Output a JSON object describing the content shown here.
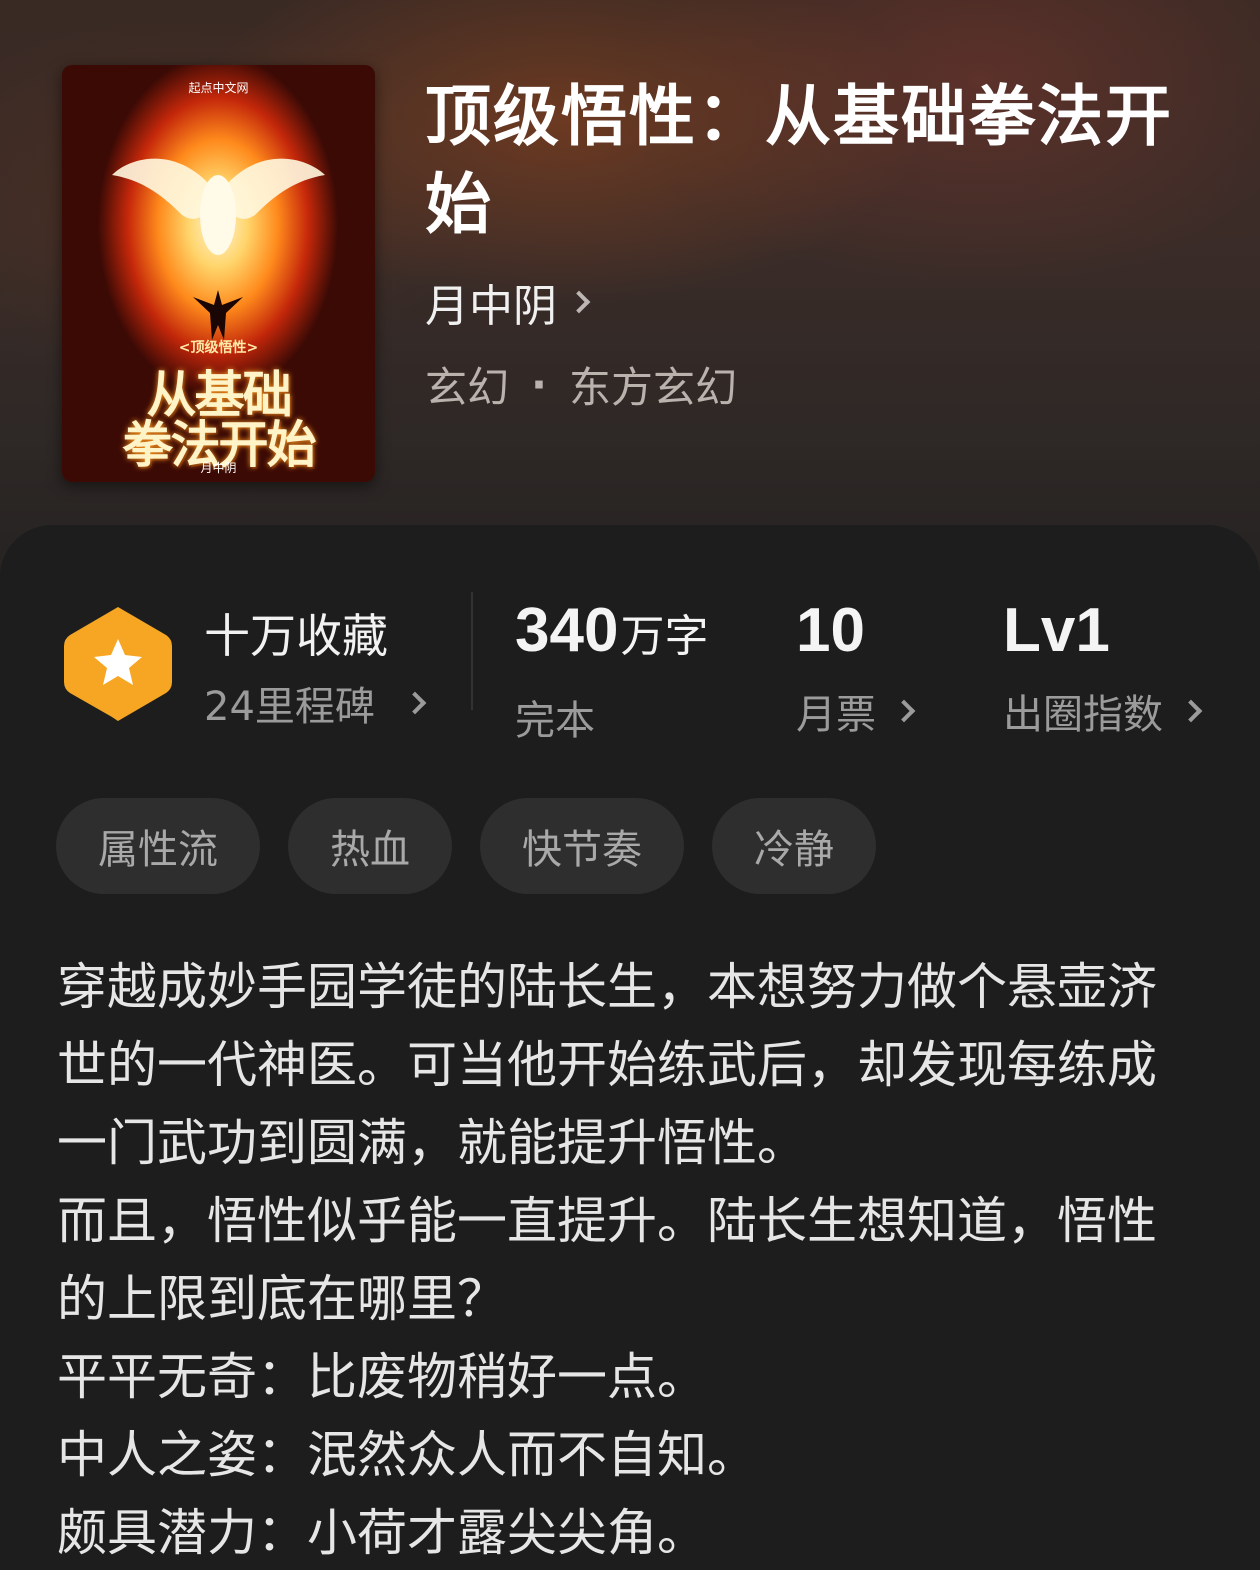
{
  "book": {
    "title": "顶级悟性：从基础拳法开始",
    "author": "月中阴",
    "genre_main": "玄幻",
    "genre_sub": "东方玄幻",
    "genre_separator": "·"
  },
  "cover": {
    "publisher": "起点中文网",
    "subtitle": "<顶级悟性>",
    "line1": "从基础",
    "line2": "拳法开始",
    "author": "月中阴"
  },
  "favorites": {
    "main": "十万收藏",
    "sub": "24里程碑",
    "icon": "star-hexagon-icon",
    "icon_color": "#f6a623"
  },
  "stats": [
    {
      "num": "340",
      "unit": "万字",
      "label": "完本"
    },
    {
      "num": "10",
      "unit": "",
      "label": "月票"
    },
    {
      "num": "Lv1",
      "unit": "",
      "label": "出圈指数"
    }
  ],
  "tags": [
    "属性流",
    "热血",
    "快节奏",
    "冷静"
  ],
  "synopsis": [
    "穿越成妙手园学徒的陆长生，本想努力做个悬壶济世的一代神医。可当他开始练武后，却发现每练成一门武功到圆满，就能提升悟性。",
    "而且，悟性似乎能一直提升。陆长生想知道，悟性的上限到底在哪里？",
    "平平无奇：比废物稍好一点。",
    "中人之姿：泯然众人而不自知。",
    "颇具潜力：小荷才露尖尖角。"
  ]
}
